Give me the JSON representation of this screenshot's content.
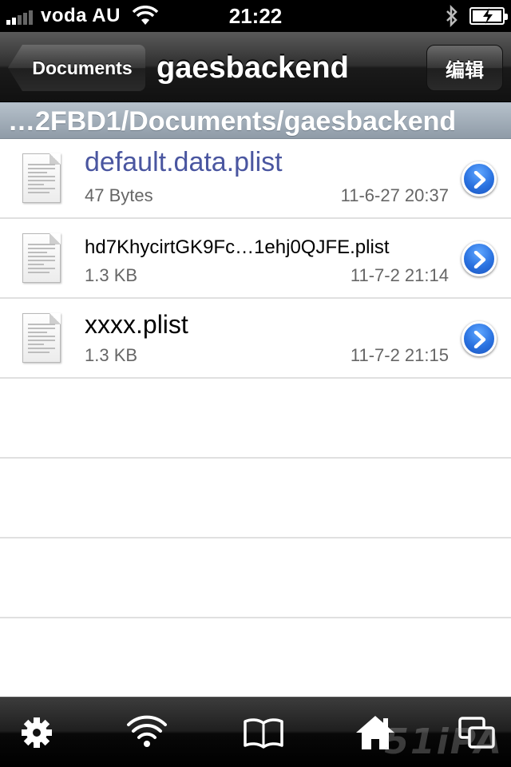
{
  "status_bar": {
    "carrier": "voda AU",
    "time": "21:22",
    "battery_level": 1.0,
    "signal_bars_on": 2,
    "signal_bars_total": 5
  },
  "nav": {
    "back_label": "Documents",
    "title": "gaesbackend",
    "edit_label": "编辑"
  },
  "path_header": "…2FBD1/Documents/gaesbackend",
  "files": [
    {
      "name": "default.data.plist",
      "size": "47 Bytes",
      "date": "11-6-27 20:37"
    },
    {
      "name": "hd7KhycirtGK9Fc…1ehj0QJFE.plist",
      "size": "1.3 KB",
      "date": "11-7-2 21:14"
    },
    {
      "name": "xxxx.plist",
      "size": "1.3 KB",
      "date": "11-7-2 21:15"
    }
  ],
  "tab_bar": {
    "items": [
      "gear-icon",
      "wifi-icon",
      "book-icon",
      "home-icon",
      "windows-icon"
    ]
  },
  "watermark": "51iPA",
  "colors": {
    "highlight_text": "#4a56a0",
    "disclosure_blue": "#2a72e0",
    "path_header": "#a4afba"
  }
}
